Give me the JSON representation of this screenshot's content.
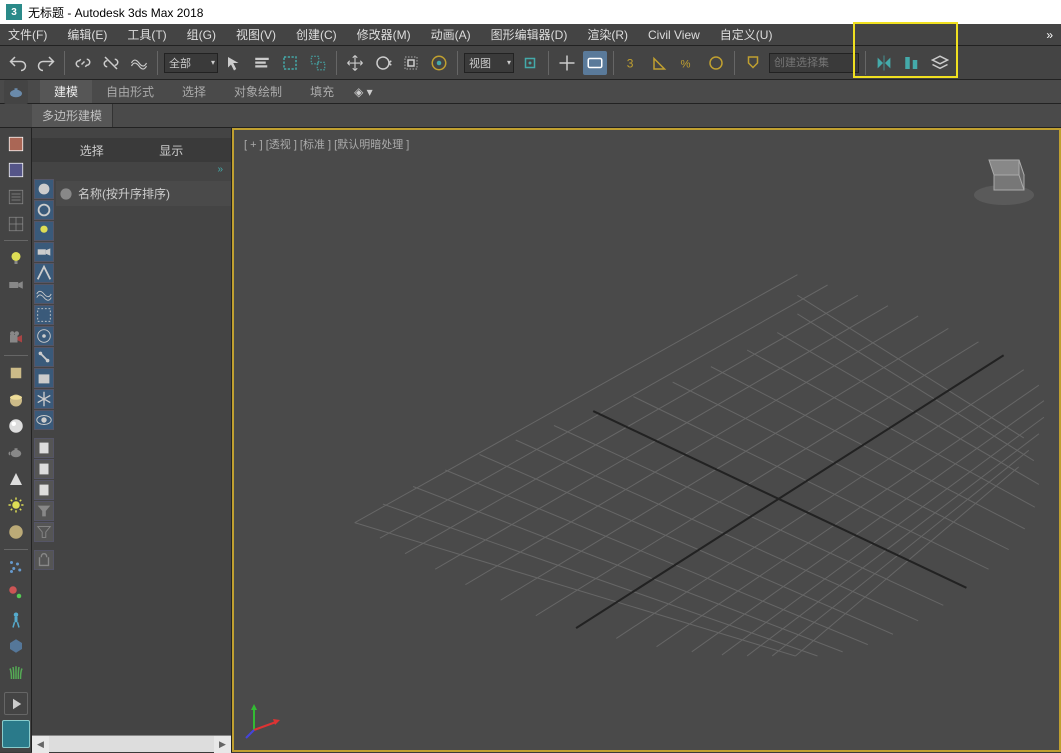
{
  "title": "无标题 - Autodesk 3ds Max 2018",
  "app_icon_text": "3",
  "menubar": {
    "file": "文件(F)",
    "edit": "编辑(E)",
    "tools": "工具(T)",
    "group": "组(G)",
    "views": "视图(V)",
    "create": "创建(C)",
    "modifiers": "修改器(M)",
    "animation": "动画(A)",
    "graph": "图形编辑器(D)",
    "rendering": "渲染(R)",
    "civil": "Civil View",
    "customize": "自定义(U)",
    "overflow": "»"
  },
  "toolbar": {
    "all_dropdown": "全部",
    "view_dropdown": "视图",
    "selection_set_placeholder": "创建选择集"
  },
  "ribbon": {
    "modeling": "建模",
    "freeform": "自由形式",
    "selection": "选择",
    "object_paint": "对象绘制",
    "populate": "填充"
  },
  "subribbon": {
    "poly_modeling": "多边形建模"
  },
  "scene_panel": {
    "select_tab": "选择",
    "display_tab": "显示",
    "expand": "»",
    "name_header": "名称(按升序排序)"
  },
  "viewport": {
    "label": "[ + ]  [透视 ]  [标准 ]  [默认明暗处理 ]"
  }
}
